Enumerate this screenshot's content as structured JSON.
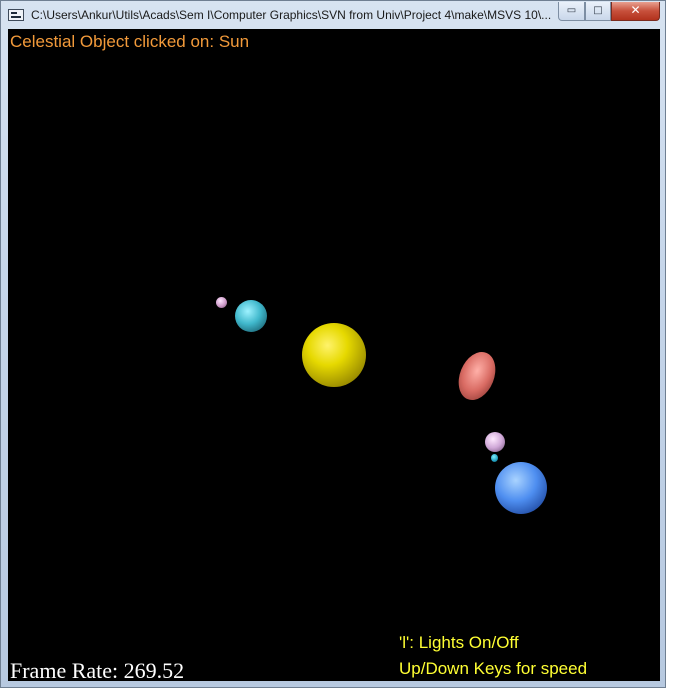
{
  "window": {
    "title": "C:\\Users\\Ankur\\Utils\\Acads\\Sem I\\Computer Graphics\\SVN from Univ\\Project 4\\make\\MSVS 10\\...",
    "minimize_glyph": "▭",
    "maximize_glyph": "□",
    "close_glyph": "✕"
  },
  "scene": {
    "status_text": "Celestial Object clicked on: Sun",
    "frame_rate_label": "Frame Rate:",
    "frame_rate_value": "269.52",
    "help_lights": "'l': Lights On/Off",
    "help_speed": "Up/Down Keys for speed",
    "colors": {
      "status_text": "#f29a3a",
      "help_text": "#ffff33",
      "frame_rate_text": "#ffffff",
      "background": "#000000"
    }
  }
}
